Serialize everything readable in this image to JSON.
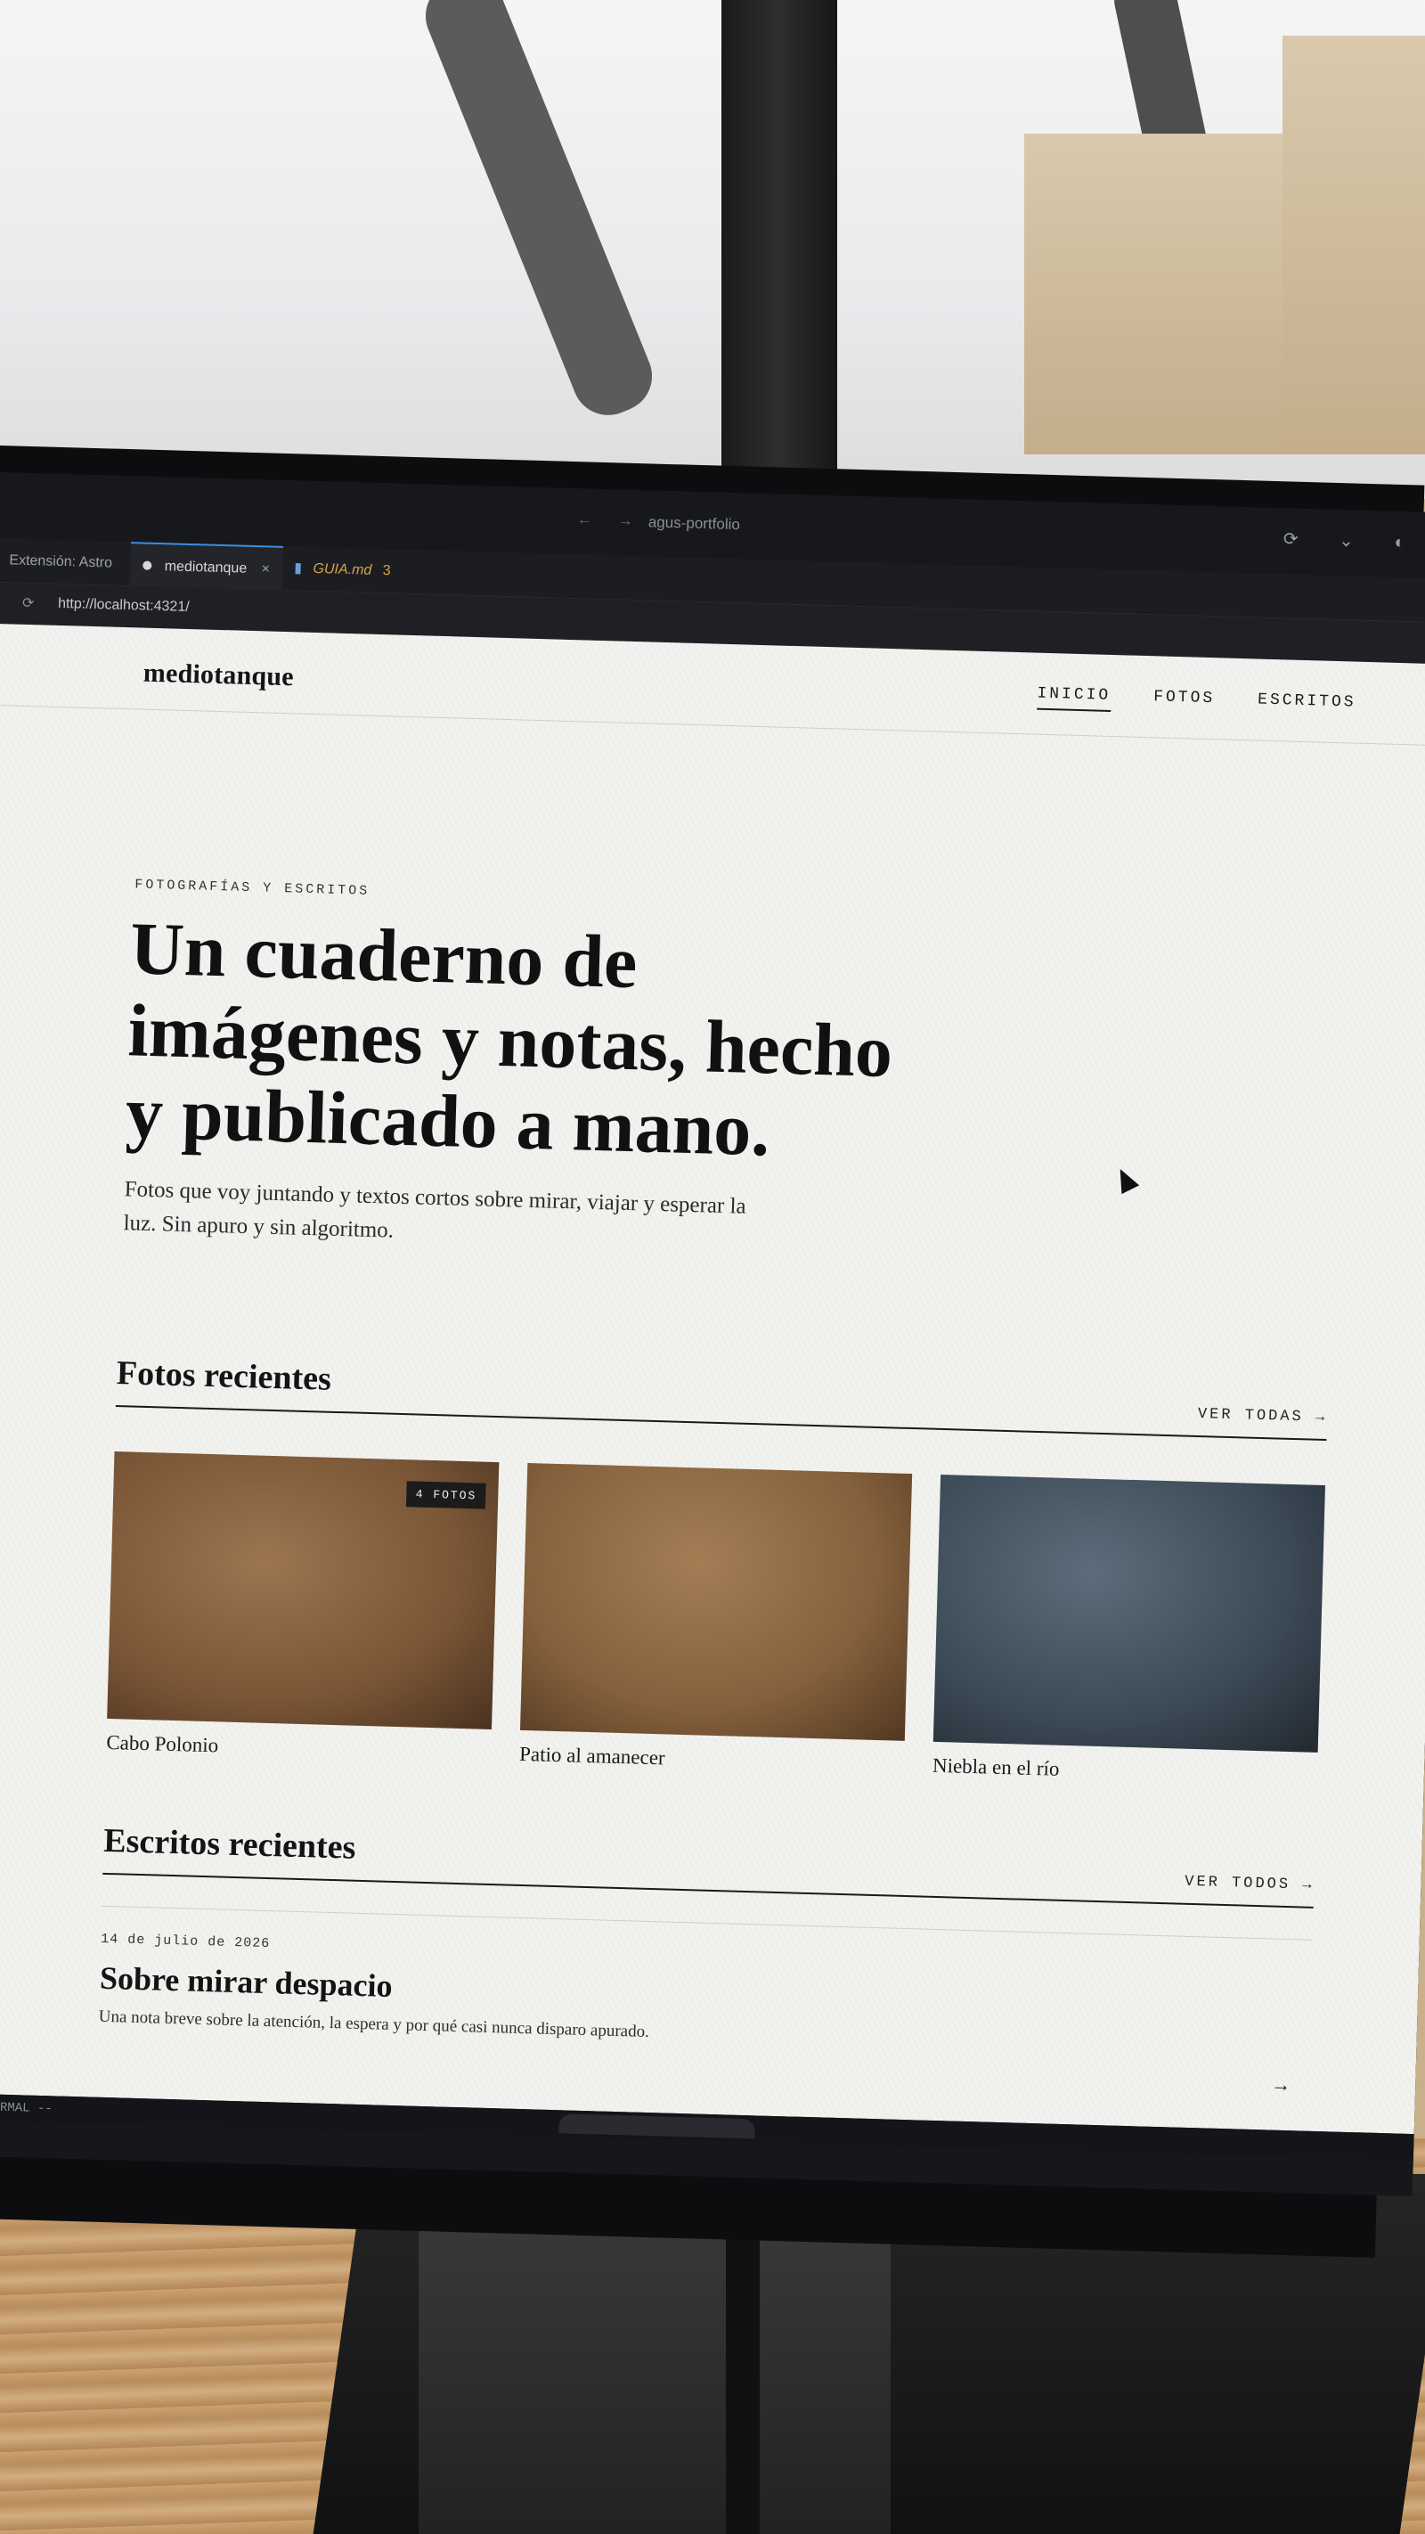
{
  "editor": {
    "window_title": "agus-portfolio",
    "nav_arrows": "← →",
    "right_icons": "⟳ ⌄ ◐",
    "tabs": [
      {
        "label": "Extensión: Astro"
      },
      {
        "label": "mediotanque",
        "close": "×"
      },
      {
        "label": "GUIA.md",
        "badge": "3"
      }
    ],
    "url": "http://localhost:4321/",
    "reload_icon": "⟳",
    "status_mode": "-- NORMAL --"
  },
  "site": {
    "brand": "mediotanque",
    "nav": [
      {
        "label": "INICIO",
        "current": true
      },
      {
        "label": "FOTOS"
      },
      {
        "label": "ESCRITOS"
      }
    ],
    "eyebrow": "FOTOGRAFÍAS Y ESCRITOS",
    "hero_title": "Un cuaderno de imágenes y notas, hecho y publicado a mano.",
    "hero_lede": "Fotos que voy juntando y textos cortos sobre mirar, viajar y esperar la luz. Sin apuro y sin algoritmo.",
    "photos_section": {
      "title": "Fotos recientes",
      "link": "VER TODAS →",
      "items": [
        {
          "caption": "Cabo Polonio",
          "badge": "4 FOTOS",
          "tone": "warm1"
        },
        {
          "caption": "Patio al amanecer",
          "tone": "warm2"
        },
        {
          "caption": "Niebla en el río",
          "tone": "cool"
        }
      ]
    },
    "writings_section": {
      "title": "Escritos recientes",
      "link": "VER TODOS →",
      "posts": [
        {
          "date": "14 de julio de 2026",
          "title": "Sobre mirar despacio",
          "excerpt": "Una nota breve sobre la atención, la espera y por qué casi nunca disparo apurado.",
          "arrow": "→"
        }
      ]
    }
  },
  "colors": {
    "accent_tab": "#3a8ee6",
    "badge_md": "#d8a24a",
    "ink": "#141414"
  }
}
